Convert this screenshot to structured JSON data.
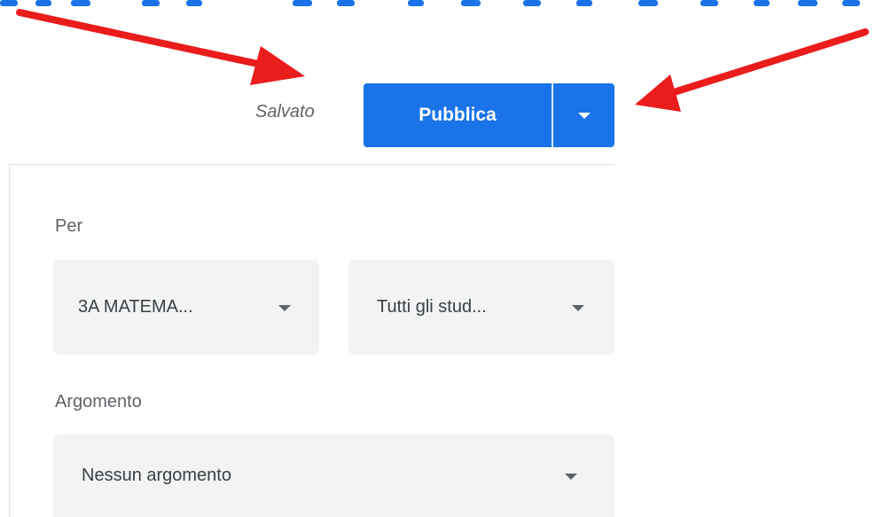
{
  "header": {
    "save_status": "Salvato",
    "publish_label": "Pubblica"
  },
  "form": {
    "for_label": "Per",
    "class_select": "3A MATEMA...",
    "students_select": "Tutti gli stud...",
    "topic_label": "Argomento",
    "topic_select": "Nessun argomento"
  },
  "colors": {
    "accent": "#1a73e8",
    "annotation_arrow": "#ea1c1c",
    "select_background": "#f1f3f4"
  },
  "icons": {
    "publish_dropdown": "chevron-down-icon",
    "select_dropdown": "caret-down-icon",
    "annotation": "red-arrow-icon"
  }
}
